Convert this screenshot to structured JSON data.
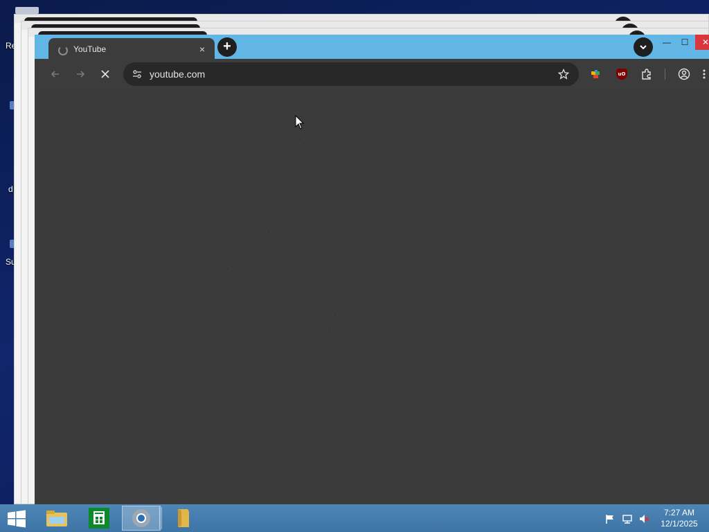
{
  "desktop": {
    "icons": [
      {
        "label": "Re"
      },
      {
        "label": "d"
      },
      {
        "label": "Su"
      }
    ]
  },
  "browser": {
    "tab": {
      "title": "YouTube",
      "close": "×"
    },
    "new_tab": "+",
    "window_controls": {
      "minimize": "—",
      "maximize": "☐",
      "close": "✕"
    },
    "toolbar": {
      "url": "youtube.com",
      "reload_state": "stop-loading"
    },
    "colors": {
      "titlebar": "#62b6e6",
      "frame": "#3c3c3c",
      "close": "#d9363e"
    }
  },
  "taskbar": {
    "apps": [
      "file-explorer",
      "store",
      "chrome",
      "folder"
    ],
    "clock": {
      "time": "7:27 AM",
      "date": "12/1/2025"
    }
  }
}
